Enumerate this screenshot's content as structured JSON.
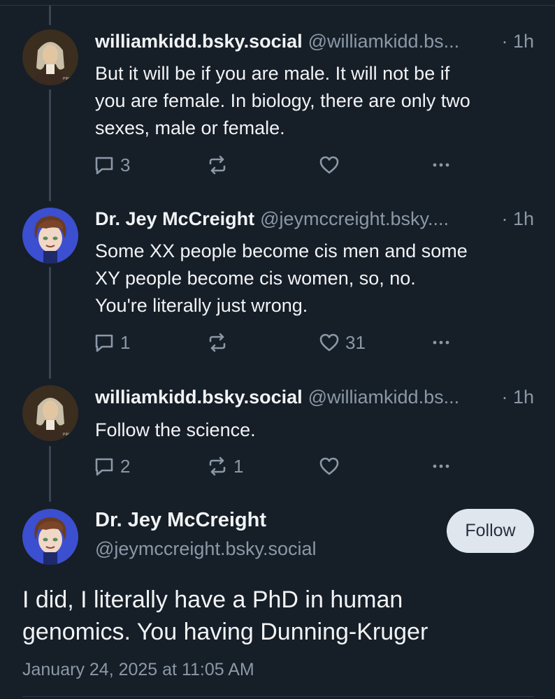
{
  "colors": {
    "background": "#161e27",
    "text": "#f1f3f5",
    "muted": "#8b98a8",
    "thread_line": "#3a4553",
    "follow_bg": "#dfe6ee"
  },
  "posts": [
    {
      "name": "williamkidd.bsky.social",
      "handle": "@williamkidd.bs...",
      "time": "· 1h",
      "avatar": "portrait-painting-avatar",
      "lines": [
        "But it will be if you are male. It will not be if",
        "you are female. In biology, there are only two",
        "sexes, male or female."
      ],
      "replies": "3",
      "reposts": "",
      "likes": ""
    },
    {
      "name": "Dr. Jey McCreight",
      "handle": "@jeymccreight.bsky....",
      "time": "· 1h",
      "avatar": "cartoon-face-avatar",
      "lines": [
        "Some XX people become cis men and some",
        "XY people become cis women, so, no.",
        "You're literally just wrong."
      ],
      "replies": "1",
      "reposts": "",
      "likes": "31"
    },
    {
      "name": "williamkidd.bsky.social",
      "handle": "@williamkidd.bs...",
      "time": "· 1h",
      "avatar": "portrait-painting-avatar",
      "lines": [
        "Follow the science."
      ],
      "replies": "2",
      "reposts": "1",
      "likes": ""
    }
  ],
  "main_post": {
    "name": "Dr. Jey McCreight",
    "handle": "@jeymccreight.bsky.social",
    "follow_label": "Follow",
    "lines": [
      "I did, I literally have a PhD in human",
      "genomics. You having Dunning-Kruger"
    ],
    "date": "January 24, 2025 at 11:05 AM"
  }
}
